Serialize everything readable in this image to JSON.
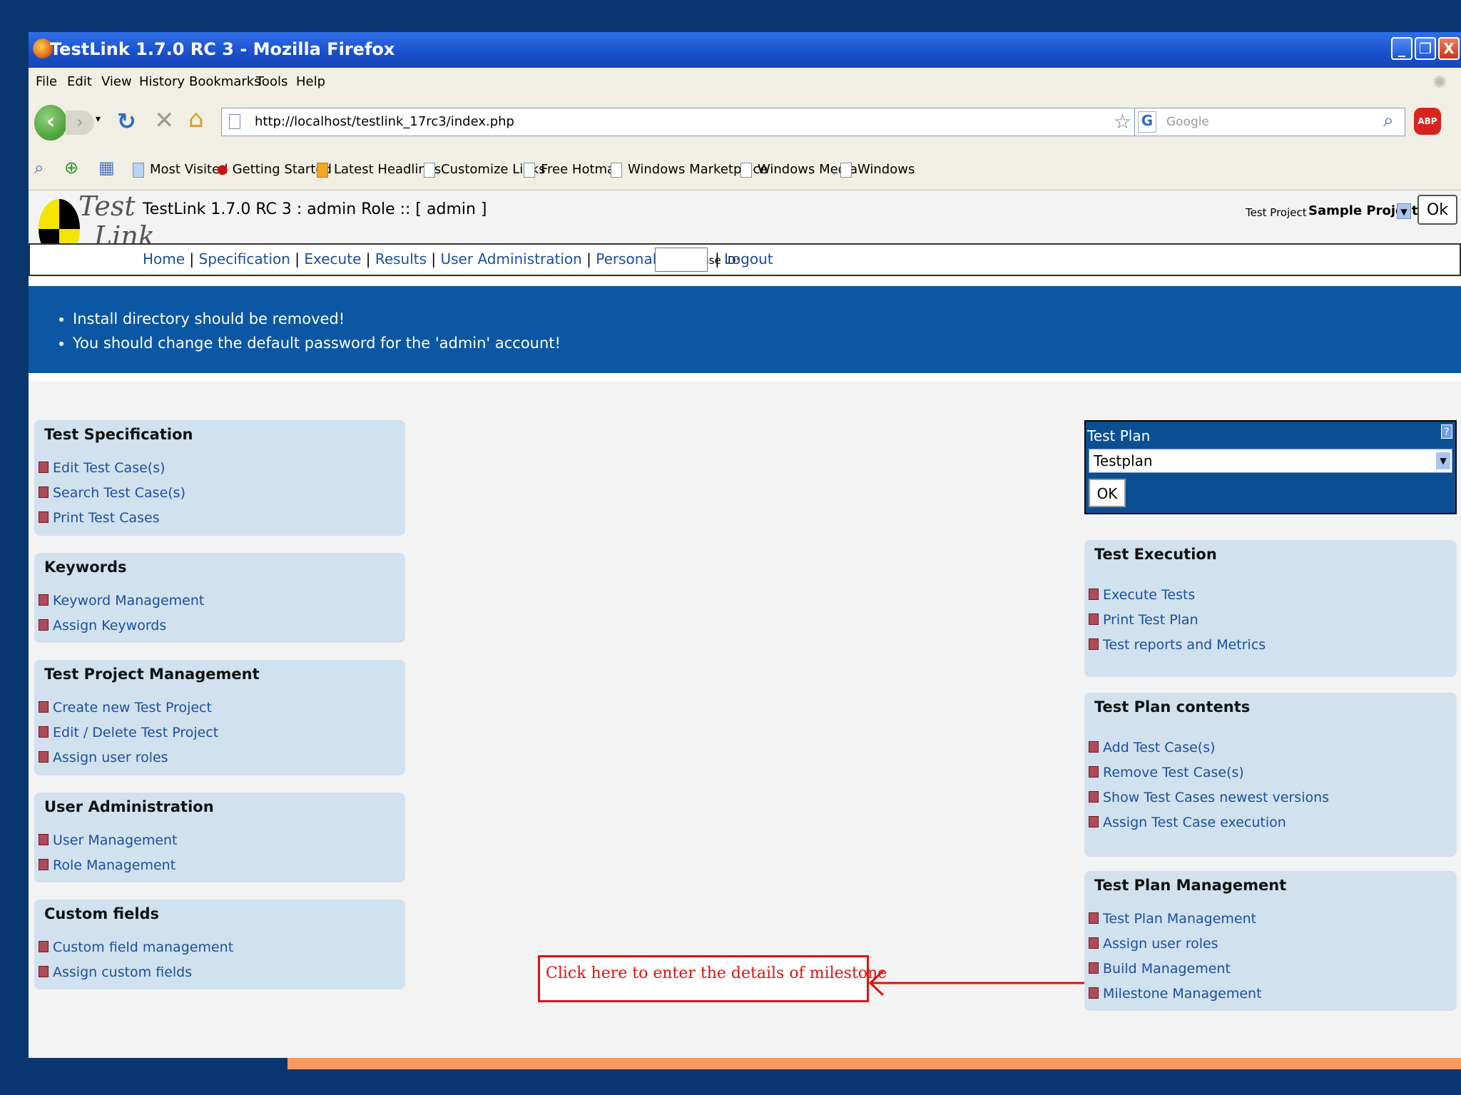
{
  "window": {
    "title": "TestLink 1.7.0 RC 3 - Mozilla Firefox"
  },
  "menu": [
    "File",
    "Edit",
    "View",
    "History",
    "Bookmarks",
    "Tools",
    "Help"
  ],
  "address_bar": {
    "url": "http://localhost/testlink_17rc3/index.php",
    "search_placeholder": "Google"
  },
  "bookmarks": [
    "Most Visited",
    "Getting Started",
    "Latest Headlines",
    "Customize Links",
    "Free Hotmail",
    "Windows Marketplace",
    "Windows Media",
    "Windows"
  ],
  "testlink": {
    "logo_top": "Test",
    "logo_bottom": "Link",
    "header_title": "TestLink 1.7.0 RC 3 : admin Role :: [ admin ]",
    "project_label": "Test Project",
    "project_value": "Sample Project",
    "project_ok": "Ok",
    "nav": [
      "Home",
      "Specification",
      "Execute",
      "Results",
      "User Administration",
      "Personal"
    ],
    "testcase_id_label": "Test Case ID:",
    "logout": "Logout"
  },
  "notices": [
    "Install directory should be removed!",
    "You should change the default password for the 'admin' account!"
  ],
  "left_panels": [
    {
      "title": "Test Specification",
      "items": [
        "Edit Test Case(s)",
        "Search Test Case(s)",
        "Print Test Cases"
      ]
    },
    {
      "title": "Keywords",
      "items": [
        "Keyword Management",
        "Assign Keywords"
      ]
    },
    {
      "title": "Test Project Management",
      "items": [
        "Create new Test Project",
        "Edit / Delete Test Project",
        "Assign user roles"
      ]
    },
    {
      "title": "User Administration",
      "items": [
        "User Management",
        "Role Management"
      ]
    },
    {
      "title": "Custom fields",
      "items": [
        "Custom field management",
        "Assign custom fields"
      ]
    }
  ],
  "test_plan": {
    "label": "Test Plan",
    "help": "?",
    "selected": "Testplan",
    "ok": "OK"
  },
  "right_panels": [
    {
      "title": "Test Execution",
      "items": [
        "Execute Tests",
        "Print Test Plan",
        "Test reports and Metrics"
      ]
    },
    {
      "title": "Test Plan contents",
      "items": [
        "Add Test Case(s)",
        "Remove Test Case(s)",
        "Show Test Cases newest versions",
        "Assign Test Case execution"
      ]
    },
    {
      "title": "Test Plan Management",
      "items": [
        "Test Plan Management",
        "Assign user roles",
        "Build Management",
        "Milestone Management"
      ]
    }
  ],
  "callout": {
    "text": "Click here to enter the details of milestone",
    "color": "#e01010"
  }
}
